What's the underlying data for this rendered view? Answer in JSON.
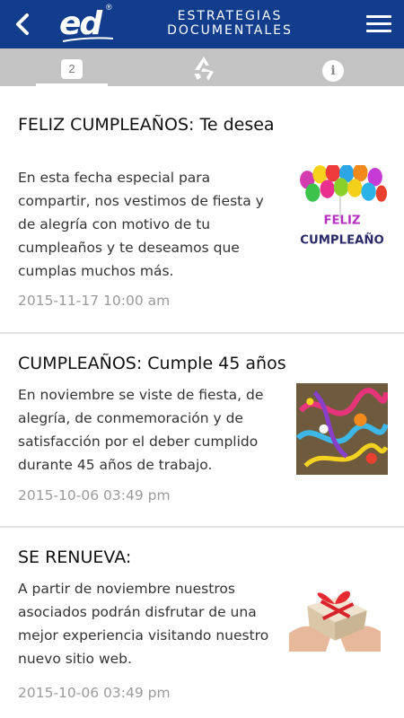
{
  "header": {
    "logo_text": "ed",
    "logo_mark": "®",
    "brand_line1": "ESTRATEGIAS",
    "brand_line2": "DOCUMENTALES",
    "back_icon": "chevron-left-icon",
    "menu_icon": "hamburger-menu-icon",
    "color": "#123d8c"
  },
  "tabs": {
    "notifications_count": "2",
    "recycle_icon": "recycle-logo-icon",
    "info_label": "i"
  },
  "posts": [
    {
      "title": "FELIZ CUMPLEAÑOS: Te desea",
      "body": "En esta fecha especial para compartir, nos vestimos de fiesta y de alegría con motivo de tu cumpleaños y te deseamos que cumplas muchos más.",
      "date": "2015-11-17 10:00 am",
      "image_text_line1": "FELIZ",
      "image_text_line2": "CUMPLEAÑO"
    },
    {
      "title": "CUMPLEAÑOS: Cumple 45 años",
      "body": "En noviembre se viste de fiesta, de alegría, de conmemoración y de satisfacción por el deber cumplido durante 45 años de trabajo.",
      "date": "2015-10-06 03:49 pm"
    },
    {
      "title": "SE RENUEVA:",
      "body": "A partir de noviembre nuestros asociados podrán disfrutar de una mejor experiencia visitando nuestro nuevo sitio web.",
      "date": "2015-10-06 03:49 pm"
    }
  ]
}
